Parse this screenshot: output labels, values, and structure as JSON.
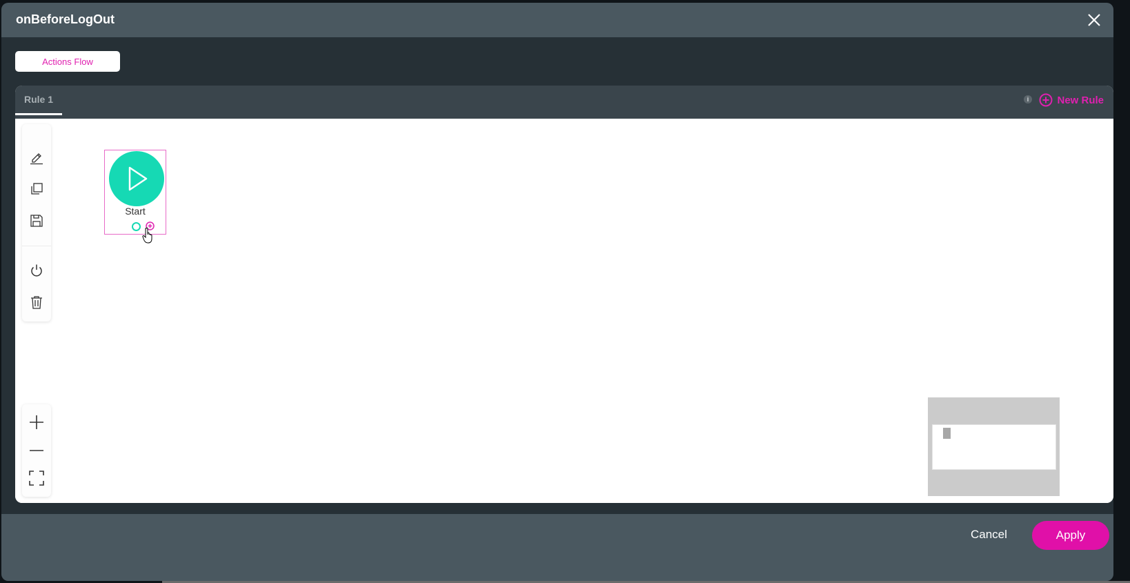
{
  "modal": {
    "title": "onBeforeLogOut",
    "close_icon": "close-icon"
  },
  "tabs": [
    {
      "label": "Actions Flow",
      "active": true
    }
  ],
  "rules": {
    "tabs": [
      {
        "label": "Rule 1",
        "active": true
      }
    ],
    "info_icon_label": "i",
    "new_rule_label": "New Rule"
  },
  "toolbar": {
    "items": [
      {
        "name": "edit",
        "icon": "pencil-icon"
      },
      {
        "name": "duplicate",
        "icon": "copy-icon"
      },
      {
        "name": "save",
        "icon": "save-icon"
      },
      {
        "name": "toggle",
        "icon": "power-icon"
      },
      {
        "name": "delete",
        "icon": "trash-icon"
      }
    ]
  },
  "zoom_controls": [
    {
      "name": "zoom-in",
      "icon": "plus-icon"
    },
    {
      "name": "zoom-out",
      "icon": "minus-icon"
    },
    {
      "name": "fit",
      "icon": "fit-screen-icon"
    }
  ],
  "flow": {
    "nodes": [
      {
        "label": "Start",
        "icon": "play-icon",
        "selected": true
      }
    ]
  },
  "footer": {
    "cancel_label": "Cancel",
    "apply_label": "Apply"
  },
  "colors": {
    "accent": "#e010a8",
    "node": "#16d9b4",
    "header": "#4a5860",
    "body": "#263036"
  }
}
